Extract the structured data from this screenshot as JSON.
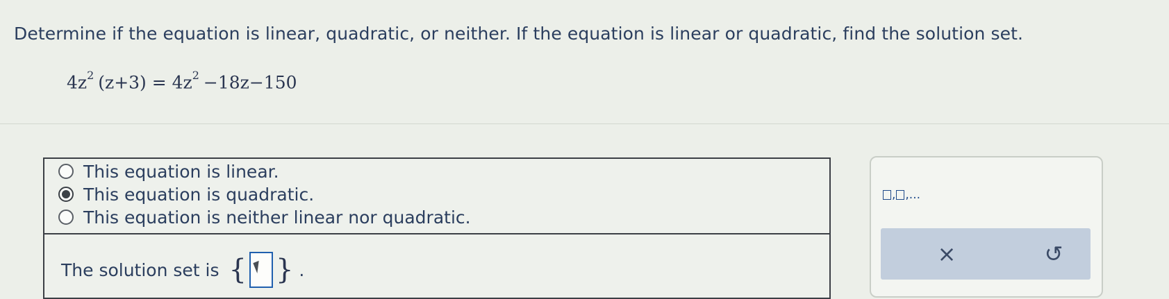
{
  "question": {
    "prompt": "Determine if the equation is linear, quadratic, or neither. If the equation is linear or quadratic, find the solution set."
  },
  "equation": {
    "lhs_coef": "4z",
    "lhs_exp": "2",
    "lhs_paren": "(z+3)",
    "equals": "=",
    "rhs_coef": "4z",
    "rhs_exp": "2",
    "rhs_rest": "−18z−150"
  },
  "options": [
    {
      "label": "This equation is linear.",
      "selected": false
    },
    {
      "label": "This equation is quadratic.",
      "selected": true
    },
    {
      "label": "This equation is neither linear nor quadratic.",
      "selected": false
    }
  ],
  "solution": {
    "label": "The solution set is",
    "open_brace": "{",
    "close_brace": "}",
    "period": "."
  },
  "palette": {
    "template_suffix": ",..."
  },
  "colors": {
    "input_border": "#1f5fae",
    "text": "#2b3e5e",
    "palette_action_bg": "#c2cedd"
  },
  "icons": {
    "clear": "×",
    "undo": "↺"
  }
}
